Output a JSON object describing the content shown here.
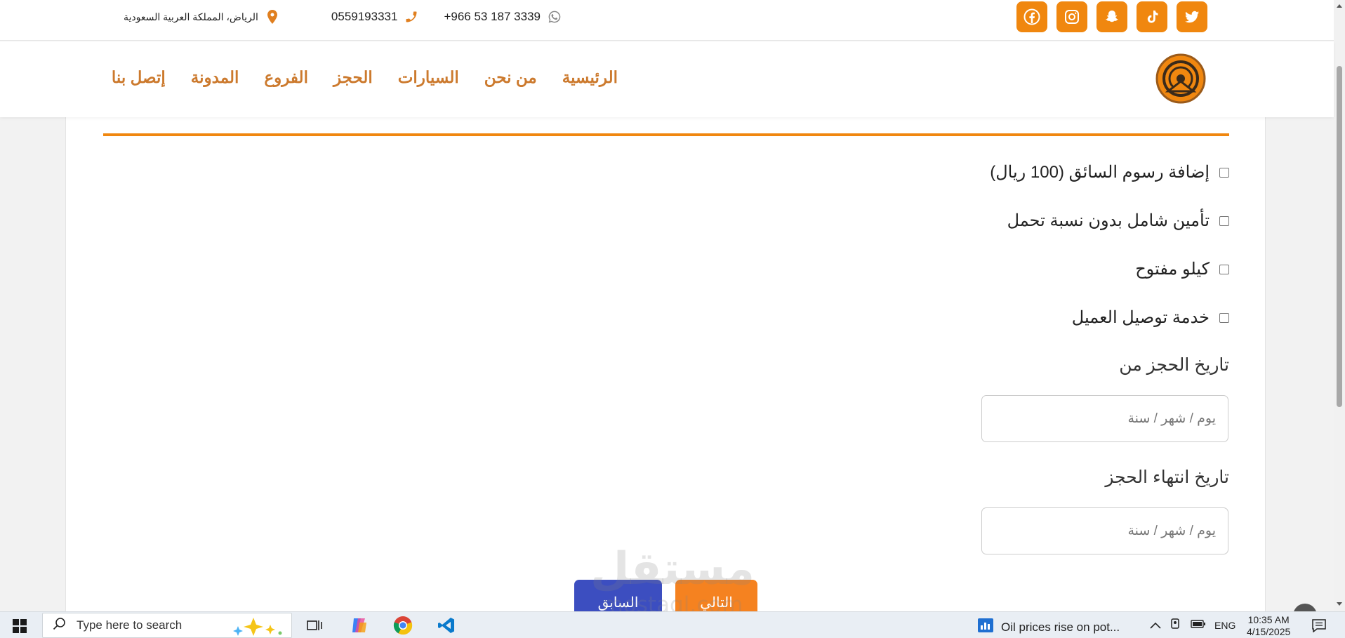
{
  "topbar": {
    "address": "الرياض، المملكة العربية السعودية",
    "phone": "0559193331",
    "whatsapp": "+966 53 187 3339",
    "social": [
      "facebook-icon",
      "instagram-icon",
      "snapchat-icon",
      "tiktok-icon",
      "twitter-icon"
    ]
  },
  "nav": {
    "items": [
      "الرئيسية",
      "من نحن",
      "السيارات",
      "الحجز",
      "الفروع",
      "المدونة",
      "إتصل بنا"
    ]
  },
  "form": {
    "options": [
      "إضافة رسوم السائق (100 ريال)",
      "تأمين شامل بدون نسبة تحمل",
      "كيلو مفتوح",
      "خدمة توصيل العميل"
    ],
    "start_label": "تاريخ الحجز من",
    "start_placeholder": "يوم / شهر / سنة",
    "end_label": "تاريخ انتهاء الحجز",
    "end_placeholder": "يوم / شهر / سنة",
    "prev_label": "السابق",
    "next_label": "التالي"
  },
  "watermark": {
    "arabic": "مستقل",
    "latin": "mostaql.com"
  },
  "taskbar": {
    "search_placeholder": "Type here to search",
    "news": "Oil prices rise on pot...",
    "lang": "ENG",
    "time": "10:35 AM",
    "date": "4/15/2025"
  },
  "colors": {
    "accent": "#f0870f",
    "nav_text": "#cc7a2e",
    "prev_button": "#3c4ec0",
    "next_button": "#f58220"
  }
}
